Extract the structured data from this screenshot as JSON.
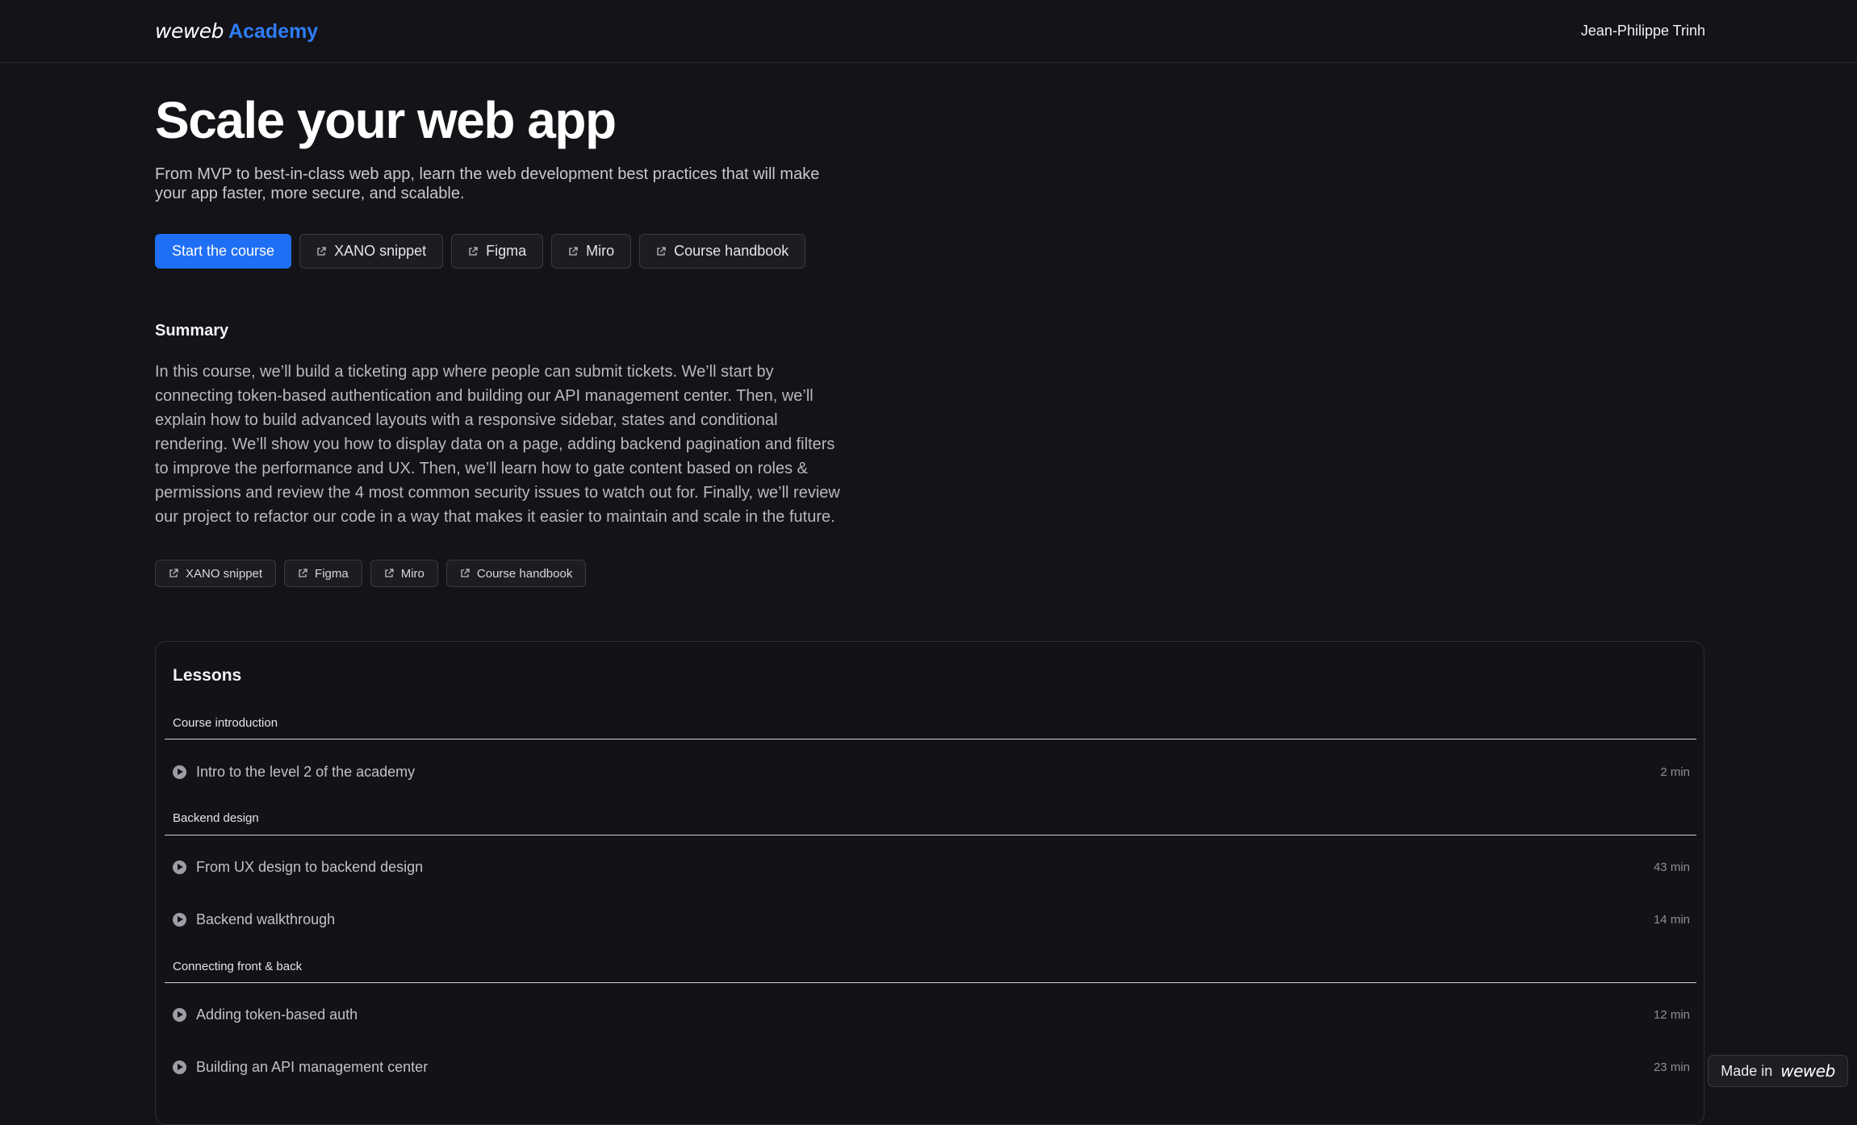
{
  "header": {
    "logo_wordmark": "weweb",
    "logo_accent": "Academy",
    "user_name": "Jean-Philippe Trinh"
  },
  "hero": {
    "title": "Scale your web app",
    "subtitle": "From MVP to best-in-class web app, learn the web development best practices that will make your app faster, more secure, and scalable.",
    "buttons": [
      {
        "label": "Start the course",
        "icon": "none",
        "primary": true
      },
      {
        "label": "XANO snippet",
        "icon": "external-link-icon"
      },
      {
        "label": "Figma",
        "icon": "external-link-icon"
      },
      {
        "label": "Miro",
        "icon": "external-link-icon"
      },
      {
        "label": "Course handbook",
        "icon": "external-link-icon"
      }
    ]
  },
  "summary": {
    "heading": "Summary",
    "text": "In this course, we’ll build a ticketing app where people can submit tickets. We’ll start by connecting token-based authentication and building our API management center. Then, we’ll explain how to build advanced layouts with a responsive sidebar, states and conditional rendering. We’ll show you how to display data on a page, adding backend pagination and filters to improve the performance and UX. Then, we’ll learn how to gate content based on roles & permissions and review the 4 most common security issues to watch out for. Finally, we’ll review our project to refactor our code in a way that makes it easier to maintain and scale in the future.",
    "chips": [
      {
        "label": "XANO snippet",
        "icon": "external-link-icon"
      },
      {
        "label": "Figma",
        "icon": "external-link-icon"
      },
      {
        "label": "Miro",
        "icon": "external-link-icon"
      },
      {
        "label": "Course handbook",
        "icon": "external-link-icon"
      }
    ]
  },
  "lessons": {
    "heading": "Lessons",
    "groups": [
      {
        "title": "Course introduction",
        "items": [
          {
            "title": "Intro to the level 2 of the academy",
            "duration": "2 min"
          }
        ]
      },
      {
        "title": "Backend design",
        "items": [
          {
            "title": "From UX design to backend design",
            "duration": "43 min"
          },
          {
            "title": "Backend walkthrough",
            "duration": "14 min"
          }
        ]
      },
      {
        "title": "Connecting front & back",
        "items": [
          {
            "title": "Adding token-based auth",
            "duration": "12 min"
          },
          {
            "title": "Building an API management center",
            "duration": "23 min"
          }
        ]
      }
    ]
  },
  "badge": {
    "prefix": "Made in",
    "logo": "weweb"
  },
  "colors": {
    "background": "#141317",
    "accent": "#1f6ff5",
    "logo_accent": "#2f7cf6"
  }
}
